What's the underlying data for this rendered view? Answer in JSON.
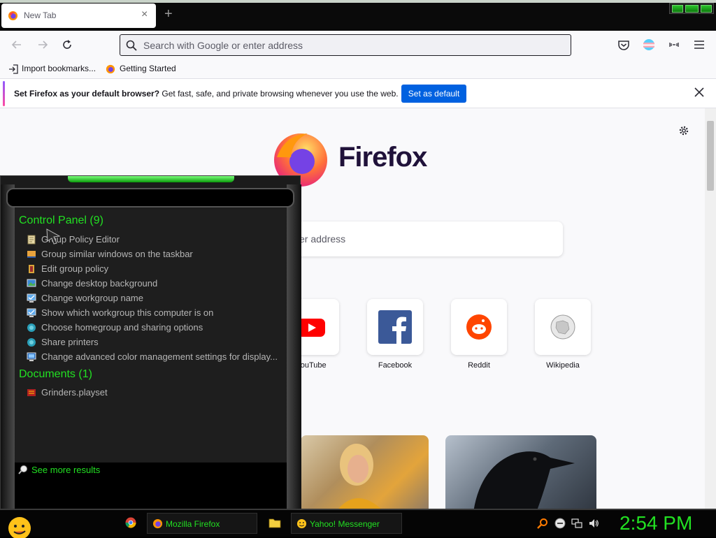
{
  "browser": {
    "tab_title": "New Tab",
    "tab_close": "×",
    "new_tab": "+",
    "url_placeholder": "Search with Google or enter address"
  },
  "bookmarks": [
    {
      "label": "Import bookmarks..."
    },
    {
      "label": "Getting Started"
    }
  ],
  "notification": {
    "bold": "Set Firefox as your default browser?",
    "text": " Get fast, safe, and private browsing whenever you use the web.",
    "button": "Set as default"
  },
  "newtab": {
    "brand": "Firefox",
    "search_placeholder_partial": "er address",
    "top_sites": [
      {
        "label": "YouTube"
      },
      {
        "label": "Facebook"
      },
      {
        "label": "Reddit"
      },
      {
        "label": "Wikipedia"
      }
    ]
  },
  "start_menu": {
    "group1_title": "Control Panel (9)",
    "group1_items": [
      {
        "label": "Group Policy Editor"
      },
      {
        "label": "Group similar windows on the taskbar"
      },
      {
        "label": "Edit group policy"
      },
      {
        "label": "Change desktop background"
      },
      {
        "label": "Change workgroup name"
      },
      {
        "label": "Show which workgroup this computer is on"
      },
      {
        "label": "Choose homegroup and sharing options"
      },
      {
        "label": "Share printers"
      },
      {
        "label": "Change advanced color management settings for display..."
      }
    ],
    "group2_title": "Documents (1)",
    "group2_items": [
      {
        "label": "Grinders.playset"
      }
    ],
    "see_more": "See more results"
  },
  "taskbar": {
    "items": [
      {
        "label": "Mozilla Firefox"
      },
      {
        "label": "Yahoo! Messenger"
      }
    ],
    "clock": "2:54 PM"
  },
  "colors": {
    "accent_green": "#22e022",
    "firefox_blue": "#0061e0"
  }
}
